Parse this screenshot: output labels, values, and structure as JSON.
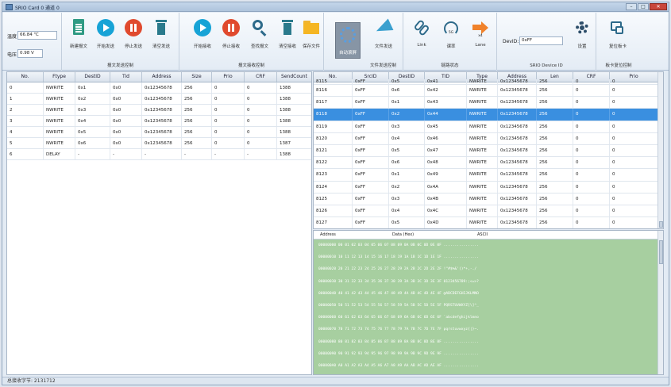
{
  "window": {
    "title": "SRIO Card 0 通道 0",
    "minimize": "–",
    "maximize": "□",
    "close": "✕"
  },
  "status_bar": {
    "text": "总接收字节: 2131712"
  },
  "sensors": {
    "temp_label": "温度",
    "temp_value": "66.84 ℃",
    "voltage_label": "电压",
    "voltage_value": "0.98 V"
  },
  "toolbar": {
    "buttons": [
      {
        "label": "新建报文",
        "icon": "document-icon"
      },
      {
        "label": "开始发送",
        "icon": "play-icon"
      },
      {
        "label": "停止发送",
        "icon": "stop-icon"
      },
      {
        "label": "清空发送",
        "icon": "trash-icon"
      },
      {
        "label": "开始接收",
        "icon": "play-icon"
      },
      {
        "label": "停止接收",
        "icon": "stop-icon"
      },
      {
        "label": "查找报文",
        "icon": "search-icon"
      },
      {
        "label": "清空接收",
        "icon": "trash-icon"
      },
      {
        "label": "保存文件",
        "icon": "folder-icon"
      },
      {
        "label": "自动滚屏",
        "icon": "autoscroll-icon"
      },
      {
        "label": "文件发送",
        "icon": "send-icon"
      },
      {
        "label": "Link",
        "icon": "link-icon"
      },
      {
        "label": "课率",
        "icon": "gauge-icon"
      },
      {
        "label": "Lane",
        "icon": "lane-arrow-icon"
      },
      {
        "label": "设置",
        "icon": "gear-icon"
      },
      {
        "label": "复位板卡",
        "icon": "reset-card-icon"
      }
    ],
    "group_labels": [
      "报文发送控制",
      "报文接收控制",
      "文件发送控制",
      "链路状态",
      "SRIO Device ID",
      "板卡复位控制"
    ],
    "devid_label": "DevID:",
    "devid_value": "0xFF",
    "gauge_caption": "5G",
    "lane_caption": "x4"
  },
  "send_table": {
    "columns": [
      "No.",
      "Ftype",
      "DestID",
      "Tid",
      "Address",
      "Size",
      "Prio",
      "CRF",
      "SendCount"
    ],
    "rows": [
      [
        "0",
        "NWRITE",
        "0x1",
        "0x0",
        "0x12345678",
        "256",
        "0",
        "0",
        "1388"
      ],
      [
        "1",
        "NWRITE",
        "0x2",
        "0x0",
        "0x12345678",
        "256",
        "0",
        "0",
        "1388"
      ],
      [
        "2",
        "NWRITE",
        "0x3",
        "0x0",
        "0x12345678",
        "256",
        "0",
        "0",
        "1388"
      ],
      [
        "3",
        "NWRITE",
        "0x4",
        "0x0",
        "0x12345678",
        "256",
        "0",
        "0",
        "1388"
      ],
      [
        "4",
        "NWRITE",
        "0x5",
        "0x0",
        "0x12345678",
        "256",
        "0",
        "0",
        "1388"
      ],
      [
        "5",
        "NWRITE",
        "0x6",
        "0x0",
        "0x12345678",
        "256",
        "0",
        "0",
        "1387"
      ],
      [
        "6",
        "DELAY",
        "-",
        "-",
        "-",
        "-",
        "-",
        "-",
        "1388"
      ]
    ]
  },
  "recv_table": {
    "columns": [
      "No.",
      "SrcID",
      "DestID",
      "TID",
      "Type",
      "Address",
      "Len",
      "CRF",
      "Prio"
    ],
    "partial_row": [
      "8115",
      "0xFF",
      "0x5",
      "0x41",
      "NWRITE",
      "0x12345678",
      "256",
      "0",
      "0"
    ],
    "rows": [
      [
        "8116",
        "0xFF",
        "0x6",
        "0x42",
        "NWRITE",
        "0x12345678",
        "256",
        "0",
        "0"
      ],
      [
        "8117",
        "0xFF",
        "0x1",
        "0x43",
        "NWRITE",
        "0x12345678",
        "256",
        "0",
        "0"
      ],
      [
        "8118",
        "0xFF",
        "0x2",
        "0x44",
        "NWRITE",
        "0x12345678",
        "256",
        "0",
        "0"
      ],
      [
        "8119",
        "0xFF",
        "0x3",
        "0x45",
        "NWRITE",
        "0x12345678",
        "256",
        "0",
        "0"
      ],
      [
        "8120",
        "0xFF",
        "0x4",
        "0x46",
        "NWRITE",
        "0x12345678",
        "256",
        "0",
        "0"
      ],
      [
        "8121",
        "0xFF",
        "0x5",
        "0x47",
        "NWRITE",
        "0x12345678",
        "256",
        "0",
        "0"
      ],
      [
        "8122",
        "0xFF",
        "0x6",
        "0x48",
        "NWRITE",
        "0x12345678",
        "256",
        "0",
        "0"
      ],
      [
        "8123",
        "0xFF",
        "0x1",
        "0x49",
        "NWRITE",
        "0x12345678",
        "256",
        "0",
        "0"
      ],
      [
        "8124",
        "0xFF",
        "0x2",
        "0x4A",
        "NWRITE",
        "0x12345678",
        "256",
        "0",
        "0"
      ],
      [
        "8125",
        "0xFF",
        "0x3",
        "0x4B",
        "NWRITE",
        "0x12345678",
        "256",
        "0",
        "0"
      ],
      [
        "8126",
        "0xFF",
        "0x4",
        "0x4C",
        "NWRITE",
        "0x12345678",
        "256",
        "0",
        "0"
      ],
      [
        "8127",
        "0xFF",
        "0x5",
        "0x4D",
        "NWRITE",
        "0x12345678",
        "256",
        "0",
        "0"
      ]
    ],
    "selected_row": "8118"
  },
  "hex_view": {
    "headers": {
      "address": "Address",
      "data": "Data (Hex)",
      "ascii": "ASCII"
    },
    "lines": [
      "00000000  00 01 02 03 04 05 06 07 08 09 0A 0B 0C 0D 0E 0F  ................",
      "00000010  10 11 12 13 14 15 16 17 18 19 1A 1B 1C 1D 1E 1F  ................",
      "00000020  20 21 22 23 24 25 26 27 28 29 2A 2B 2C 2D 2E 2F   !\"#$%&'()*+,-./",
      "00000030  30 31 32 33 34 35 36 37 38 39 3A 3B 3C 3D 3E 3F  0123456789:;<=>?",
      "00000040  40 41 42 43 44 45 46 47 48 49 4A 4B 4C 4D 4E 4F  @ABCDEFGHIJKLMNO",
      "00000050  50 51 52 53 54 55 56 57 58 59 5A 5B 5C 5D 5E 5F  PQRSTUVWXYZ[\\]^_",
      "00000060  60 61 62 63 64 65 66 67 68 69 6A 6B 6C 6D 6E 6F  `abcdefghijklmno",
      "00000070  70 71 72 73 74 75 76 77 78 79 7A 7B 7C 7D 7E 7F  pqrstuvwxyz{|}~.",
      "00000080  80 81 82 83 84 85 86 87 88 89 8A 8B 8C 8D 8E 8F  ................",
      "00000090  90 91 92 93 94 95 96 97 98 99 9A 9B 9C 9D 9E 9F  ................",
      "000000A0  A0 A1 A2 A3 A4 A5 A6 A7 A8 A9 AA AB AC AD AE AF  ................",
      "000000B0  B0 B1 B2 B3 B4 B5 B6 B7 B8 B9 BA BB BC BD BE BF  ................"
    ]
  }
}
